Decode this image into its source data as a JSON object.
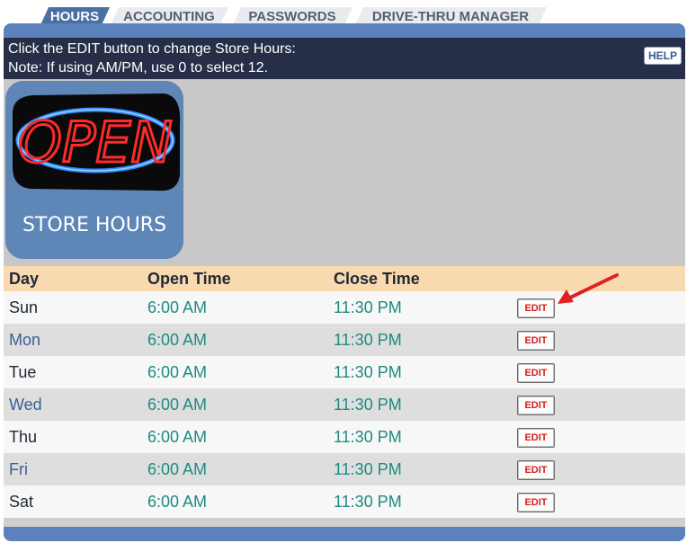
{
  "tabs": [
    "HOURS",
    "ACCOUNTING",
    "PASSWORDS",
    "DRIVE-THRU MANAGER"
  ],
  "instructions": {
    "line1": "Click the EDIT button to change Store Hours:",
    "line2": "Note: If using AM/PM, use 0 to select 12."
  },
  "help_label": "HELP",
  "logo": {
    "sign_text": "OPEN",
    "caption": "STORE HOURS"
  },
  "table": {
    "headers": [
      "Day",
      "Open Time",
      "Close Time"
    ],
    "edit_label": "EDIT",
    "rows": [
      {
        "day": "Sun",
        "open": "6:00 AM",
        "close": "11:30 PM"
      },
      {
        "day": "Mon",
        "open": "6:00 AM",
        "close": "11:30 PM"
      },
      {
        "day": "Tue",
        "open": "6:00 AM",
        "close": "11:30 PM"
      },
      {
        "day": "Wed",
        "open": "6:00 AM",
        "close": "11:30 PM"
      },
      {
        "day": "Thu",
        "open": "6:00 AM",
        "close": "11:30 PM"
      },
      {
        "day": "Fri",
        "open": "6:00 AM",
        "close": "11:30 PM"
      },
      {
        "day": "Sat",
        "open": "6:00 AM",
        "close": "11:30 PM"
      }
    ]
  },
  "colors": {
    "tab_active": "#4a6fa5",
    "instruction_bar": "#262f47",
    "header_row": "#f9d9b0",
    "time_text": "#1e8a82",
    "edit_text": "#d81e1e",
    "arrow": "#e02020"
  }
}
